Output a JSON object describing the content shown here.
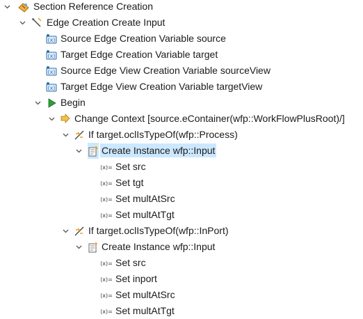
{
  "tree": {
    "section": {
      "label": "Section Reference Creation",
      "icon": "section-icon"
    },
    "edge_creation": {
      "label": "Edge Creation Create Input",
      "icon": "edge-creation-icon"
    },
    "variables": [
      {
        "label": "Source Edge Creation Variable source",
        "icon": "variable-icon"
      },
      {
        "label": "Target Edge Creation Variable target",
        "icon": "variable-icon"
      },
      {
        "label": "Source Edge View Creation Variable sourceView",
        "icon": "variable-icon"
      },
      {
        "label": "Target Edge View Creation Variable targetView",
        "icon": "variable-icon"
      }
    ],
    "begin": {
      "label": "Begin",
      "icon": "begin-icon"
    },
    "change_context": {
      "label": "Change Context [source.eContainer(wfp::WorkFlowPlusRoot)/]",
      "icon": "change-context-icon"
    },
    "if_process": {
      "label": "If target.oclIsTypeOf(wfp::Process)",
      "icon": "if-icon",
      "create_instance": {
        "label": "Create Instance wfp::Input",
        "icon": "create-instance-icon",
        "selected": true
      },
      "sets": [
        "Set src",
        "Set tgt",
        "Set multAtSrc",
        "Set multAtTgt"
      ]
    },
    "if_inport": {
      "label": "If target.oclIsTypeOf(wfp::InPort)",
      "icon": "if-icon",
      "create_instance": {
        "label": "Create Instance wfp::Input",
        "icon": "create-instance-icon",
        "selected": false
      },
      "sets": [
        "Set src",
        "Set inport",
        "Set multAtSrc",
        "Set multAtTgt"
      ]
    }
  },
  "colors": {
    "selection": "#cce8ff",
    "begin_green": "#2e9e3a",
    "variable_blue": "#2a6fb5",
    "context_orange": "#e8a11c"
  }
}
